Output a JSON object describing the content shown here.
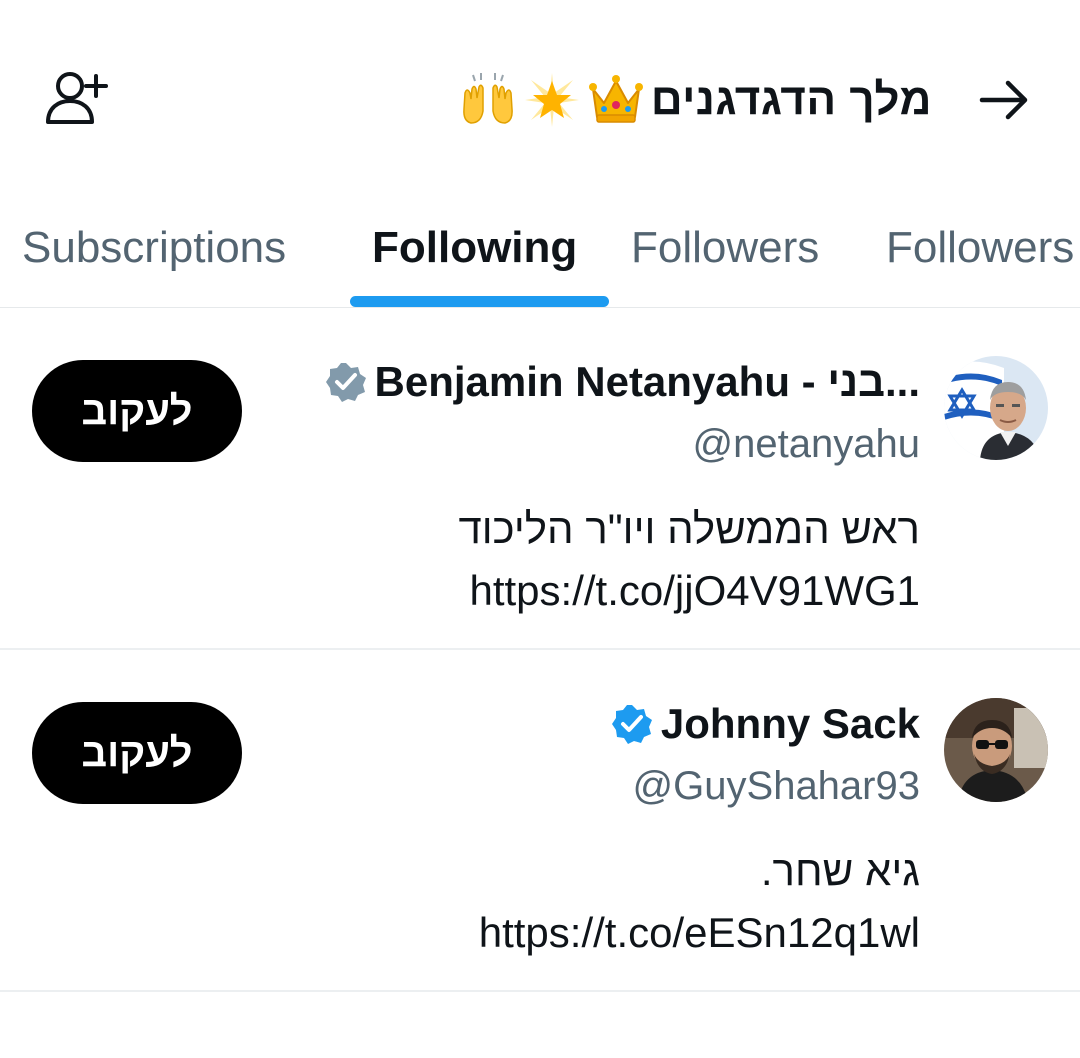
{
  "header": {
    "title": "מלך הדגדגנים",
    "title_emoji": [
      "raising-hands",
      "glowing-star",
      "crown"
    ],
    "add_user_icon": "add-user-icon",
    "back_icon": "arrow-right-icon"
  },
  "tabs": [
    {
      "label": "Subscriptions",
      "active": false
    },
    {
      "label": "Following",
      "active": true
    },
    {
      "label": "Followers",
      "active": false
    },
    {
      "label": "Followers",
      "active": false
    }
  ],
  "accounts": [
    {
      "name": "Benjamin Netanyahu - בני...",
      "handle": "@netanyahu",
      "verified_color": "#829aab",
      "bio_line1": "ראש הממשלה ויו\"ר הליכוד",
      "bio_link": "https://t.co/jjO4V91WG1",
      "follow_label": "לעקוב"
    },
    {
      "name": "Johnny Sack",
      "handle": "@GuyShahar93",
      "verified_color": "#1d9bf0",
      "bio_line1": "גיא שחר.",
      "bio_link": "https://t.co/eESn12q1wl",
      "follow_label": "לעקוב"
    }
  ],
  "colors": {
    "accent": "#1d9bf0",
    "text_primary": "#0f1419",
    "text_secondary": "#536471",
    "button_bg": "#000000"
  }
}
